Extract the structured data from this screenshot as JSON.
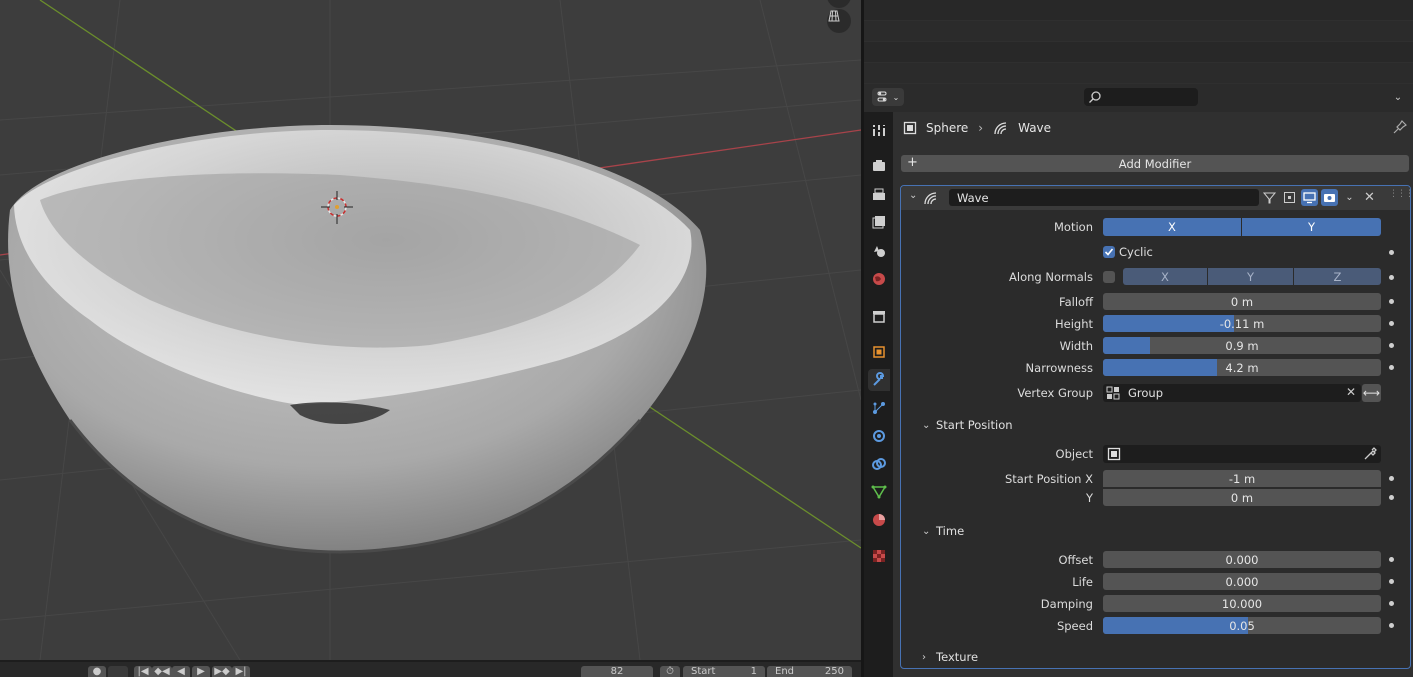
{
  "properties_header": {
    "editor_type_icon": "properties-editor-icon",
    "search_placeholder": "",
    "breadcrumb_object": "Sphere",
    "breadcrumb_modifier": "Wave"
  },
  "add_modifier_label": "Add Modifier",
  "modifier": {
    "name": "Wave",
    "motion_label": "Motion",
    "motion_x": "X",
    "motion_y": "Y",
    "cyclic_label": "Cyclic",
    "cyclic_checked": true,
    "along_normals_label": "Along Normals",
    "along_normals_checked": false,
    "along_x": "X",
    "along_y": "Y",
    "along_z": "Z",
    "falloff_label": "Falloff",
    "falloff_value": "0 m",
    "height_label": "Height",
    "height_value": "-0.11 m",
    "height_fill": 0.47,
    "width_label": "Width",
    "width_value": "0.9 m",
    "width_fill": 0.17,
    "narrowness_label": "Narrowness",
    "narrowness_value": "4.2 m",
    "narrowness_fill": 0.41,
    "vertex_group_label": "Vertex Group",
    "vertex_group_value": "Group",
    "start_position": {
      "title": "Start Position",
      "object_label": "Object",
      "object_value": "",
      "x_label": "Start Position X",
      "x_value": "-1 m",
      "y_label": "Y",
      "y_value": "0 m"
    },
    "time": {
      "title": "Time",
      "offset_label": "Offset",
      "offset_value": "0.000",
      "life_label": "Life",
      "life_value": "0.000",
      "damping_label": "Damping",
      "damping_value": "10.000",
      "speed_label": "Speed",
      "speed_value": "0.05",
      "speed_fill": 0.52
    },
    "texture_title": "Texture"
  },
  "timeline": {
    "frame_current": "82",
    "start_label": "Start",
    "start_value": "1",
    "end_label": "End",
    "end_value": "250"
  },
  "colors": {
    "accent": "#4772b3",
    "x_axis": "#a8434a",
    "y_axis": "#6b8e2c",
    "viewport_bg": "#3d3d3d"
  },
  "tabs": [
    "tool-icon",
    "render-icon",
    "output-icon",
    "view-layer-icon",
    "scene-icon",
    "world-icon",
    "collection-icon",
    "object-icon",
    "modifier-icon",
    "particles-icon",
    "physics-icon",
    "constraints-icon",
    "data-icon",
    "material-icon",
    "texture-icon"
  ]
}
